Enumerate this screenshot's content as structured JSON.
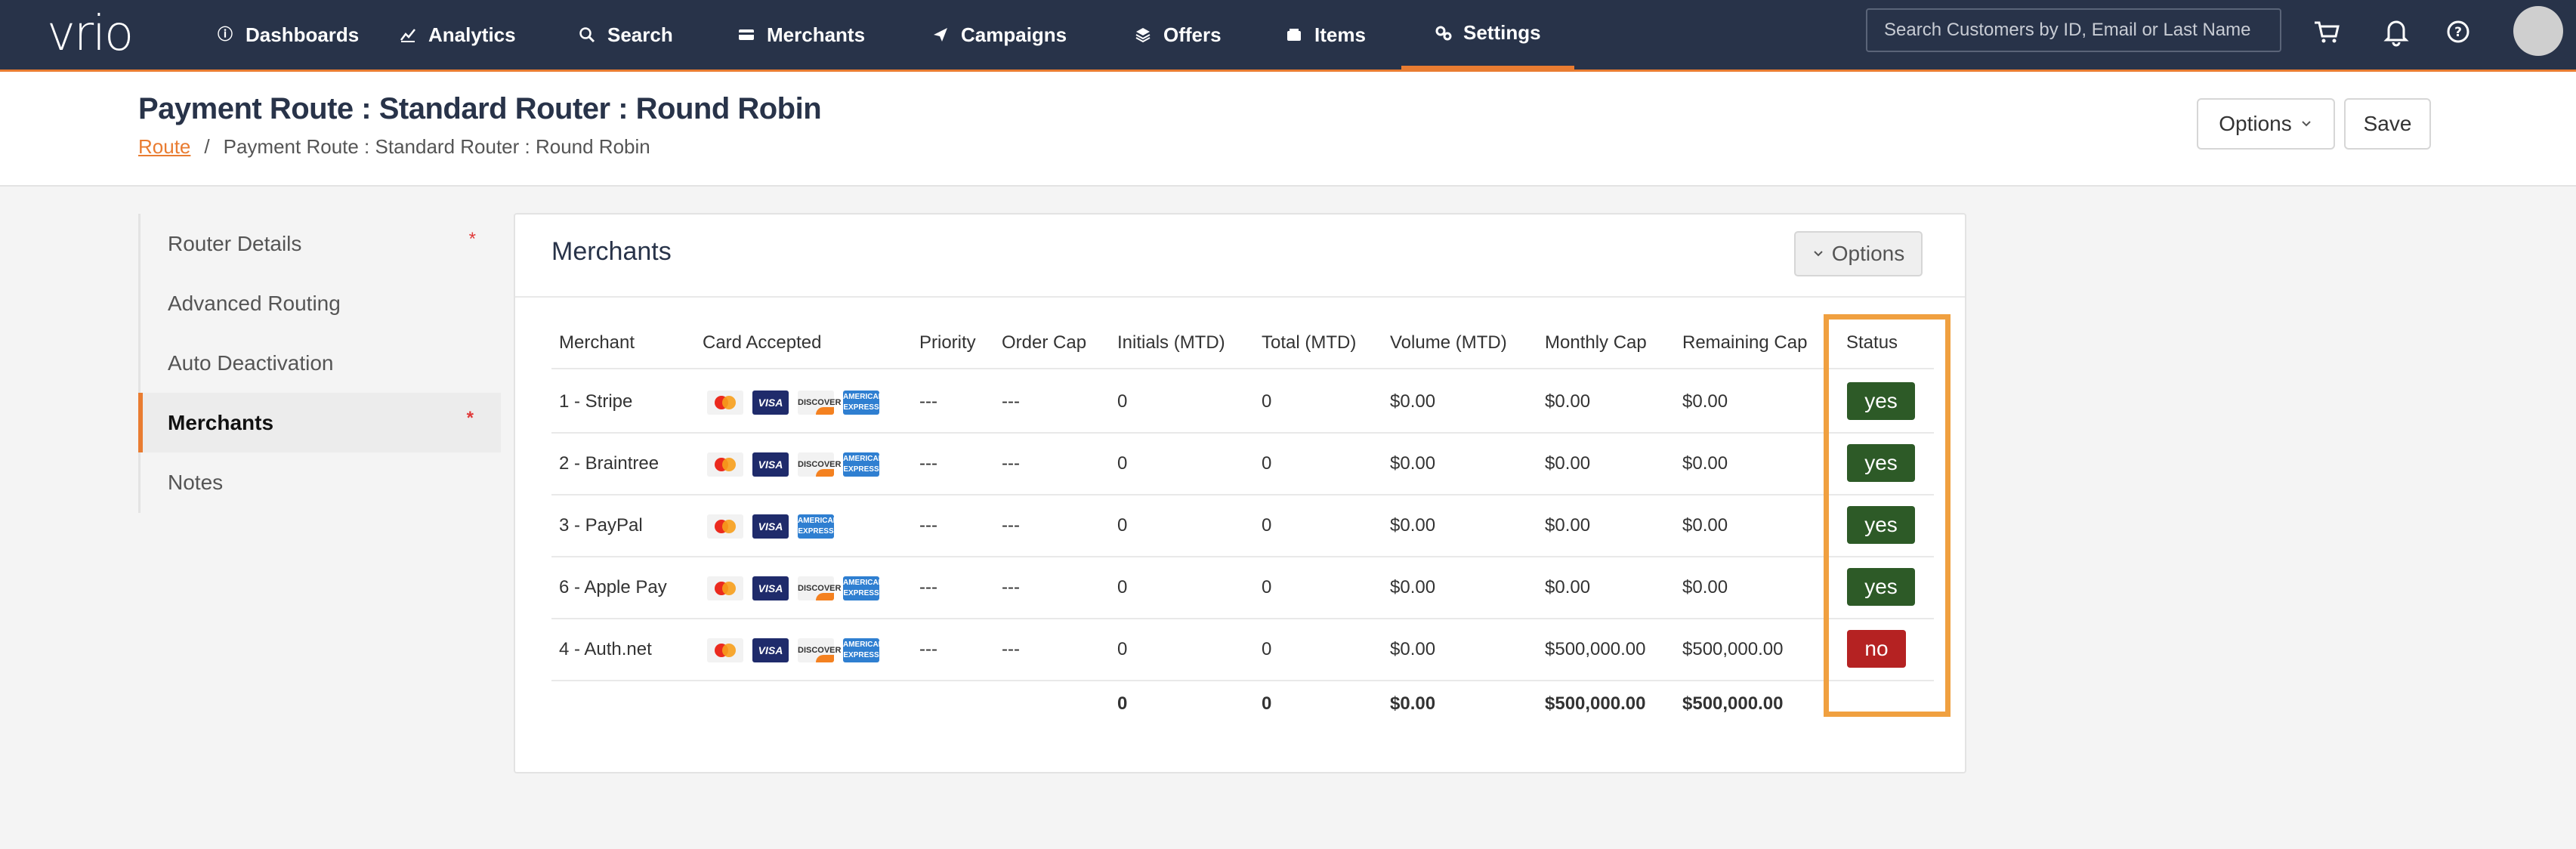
{
  "nav": {
    "logo": "vrio",
    "items": [
      {
        "label": "Dashboards",
        "icon": "info-icon"
      },
      {
        "label": "Analytics",
        "icon": "chart-icon"
      },
      {
        "label": "Search",
        "icon": "search-icon"
      },
      {
        "label": "Merchants",
        "icon": "card-icon"
      },
      {
        "label": "Campaigns",
        "icon": "send-icon"
      },
      {
        "label": "Offers",
        "icon": "layers-icon"
      },
      {
        "label": "Items",
        "icon": "box-icon"
      },
      {
        "label": "Settings",
        "icon": "gears-icon"
      }
    ],
    "active": "Settings",
    "search_placeholder": "Search Customers by ID, Email or Last Name"
  },
  "header": {
    "title": "Payment Route : Standard Router : Round Robin",
    "breadcrumb_link": "Route",
    "breadcrumb_sep": "/",
    "breadcrumb_current": "Payment Route : Standard Router : Round Robin",
    "options_label": "Options",
    "save_label": "Save"
  },
  "sidemenu": {
    "items": [
      {
        "label": "Router Details",
        "required": "*"
      },
      {
        "label": "Advanced Routing",
        "required": ""
      },
      {
        "label": "Auto Deactivation",
        "required": ""
      },
      {
        "label": "Merchants",
        "required": "*"
      },
      {
        "label": "Notes",
        "required": ""
      }
    ],
    "active": "Merchants"
  },
  "card": {
    "title": "Merchants",
    "options_label": "Options"
  },
  "table": {
    "headers": [
      "Merchant",
      "Card Accepted",
      "Priority",
      "Order Cap",
      "Initials (MTD)",
      "Total (MTD)",
      "Volume (MTD)",
      "Monthly Cap",
      "Remaining Cap",
      "Status"
    ],
    "rows": [
      {
        "merchant": "1 - Stripe",
        "cards": [
          "mastercard",
          "visa",
          "discover",
          "amex"
        ],
        "priority": "---",
        "order_cap": "---",
        "initials": "0",
        "total": "0",
        "volume": "$0.00",
        "monthly_cap": "$0.00",
        "remaining_cap": "$0.00",
        "status": "yes"
      },
      {
        "merchant": "2 - Braintree",
        "cards": [
          "mastercard",
          "visa",
          "discover",
          "amex"
        ],
        "priority": "---",
        "order_cap": "---",
        "initials": "0",
        "total": "0",
        "volume": "$0.00",
        "monthly_cap": "$0.00",
        "remaining_cap": "$0.00",
        "status": "yes"
      },
      {
        "merchant": "3 - PayPal",
        "cards": [
          "mastercard",
          "visa",
          "amex"
        ],
        "priority": "---",
        "order_cap": "---",
        "initials": "0",
        "total": "0",
        "volume": "$0.00",
        "monthly_cap": "$0.00",
        "remaining_cap": "$0.00",
        "status": "yes"
      },
      {
        "merchant": "6 - Apple Pay",
        "cards": [
          "mastercard",
          "visa",
          "discover",
          "amex"
        ],
        "priority": "---",
        "order_cap": "---",
        "initials": "0",
        "total": "0",
        "volume": "$0.00",
        "monthly_cap": "$0.00",
        "remaining_cap": "$0.00",
        "status": "yes"
      },
      {
        "merchant": "4 - Auth.net",
        "cards": [
          "mastercard",
          "visa",
          "discover",
          "amex"
        ],
        "priority": "---",
        "order_cap": "---",
        "initials": "0",
        "total": "0",
        "volume": "$0.00",
        "monthly_cap": "$500,000.00",
        "remaining_cap": "$500,000.00",
        "status": "no"
      }
    ],
    "totals": {
      "initials": "0",
      "total": "0",
      "volume": "$0.00",
      "monthly_cap": "$500,000.00",
      "remaining_cap": "$500,000.00"
    },
    "card_labels": {
      "visa": "VISA",
      "discover": "DISCOVER",
      "amex": "AMERICAN EXPRESS"
    }
  },
  "colors": {
    "nav_bg": "#283349",
    "accent": "#e97c31",
    "yes": "#2d5a27",
    "no": "#b52222",
    "highlight": "#f0a040"
  }
}
